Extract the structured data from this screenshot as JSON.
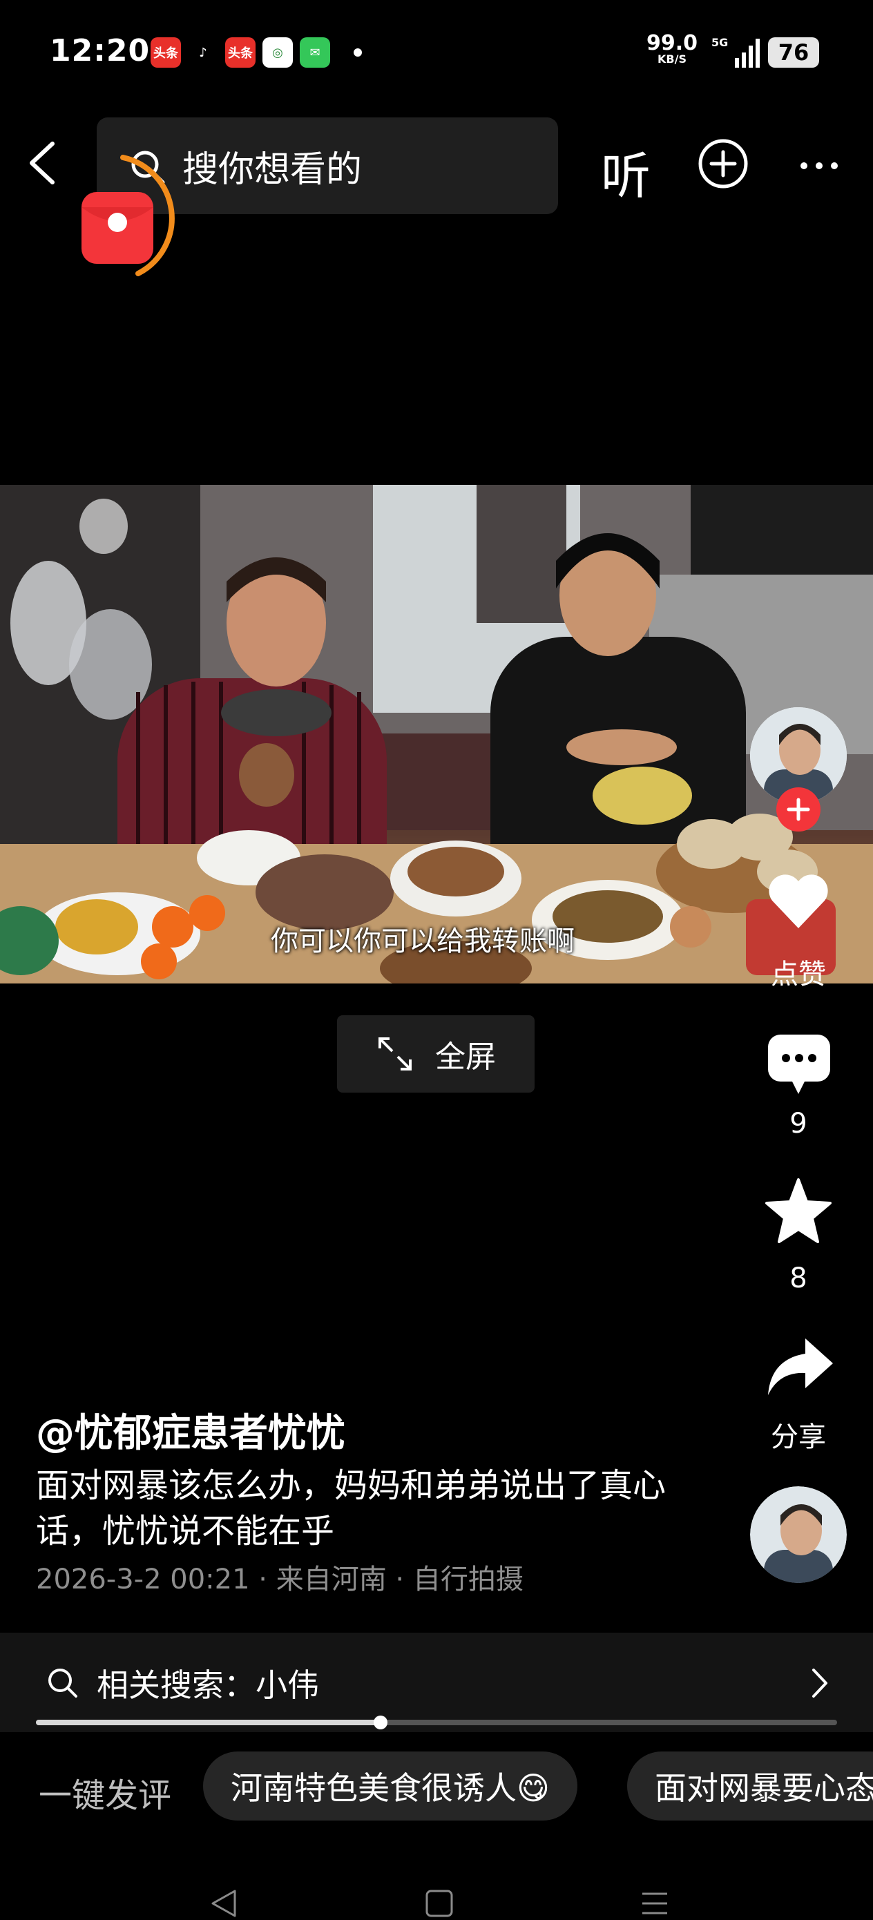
{
  "status_bar": {
    "time": "12:20",
    "apps": [
      {
        "icon": "toutiao-icon",
        "text": "头条",
        "color": "#e8302a"
      },
      {
        "icon": "tiktok-icon",
        "text": "♪",
        "color": "#000000"
      },
      {
        "icon": "toutiao-lite-icon",
        "text": "头条",
        "color": "#e8302a"
      },
      {
        "icon": "china-mobile-icon",
        "text": "◎",
        "color": "#ffffff"
      },
      {
        "icon": "messages-icon",
        "text": "✉",
        "color": "#34c759"
      }
    ],
    "net_speed": "99.0",
    "net_unit": "KB/S",
    "network": "5G",
    "battery": "76"
  },
  "top_bar": {
    "search_placeholder": "搜你想看的",
    "listen_label": "听"
  },
  "video": {
    "caption": "你可以你可以给我转账啊",
    "fullscreen_label": "全屏"
  },
  "side_actions": {
    "like_label": "点赞",
    "comment_count": "9",
    "favorite_count": "8",
    "share_label": "分享"
  },
  "post": {
    "author": "@忧郁症患者忧忧",
    "description": "面对网暴该怎么办，妈妈和弟弟说出了真心话，忧忧说不能在乎",
    "meta": "2026-3-2 00:21 · 来自河南 · 自行拍摄"
  },
  "related_search": {
    "label": "相关搜索：小伟"
  },
  "playback": {
    "progress": 0.43
  },
  "quick_comment": {
    "label": "一键发评",
    "chips": [
      "河南特色美食很诱人😋",
      "面对网暴要心态"
    ]
  },
  "colors": {
    "accent_red": "#f3353a",
    "ring_orange": "#f28c1b",
    "background": "#000000"
  }
}
